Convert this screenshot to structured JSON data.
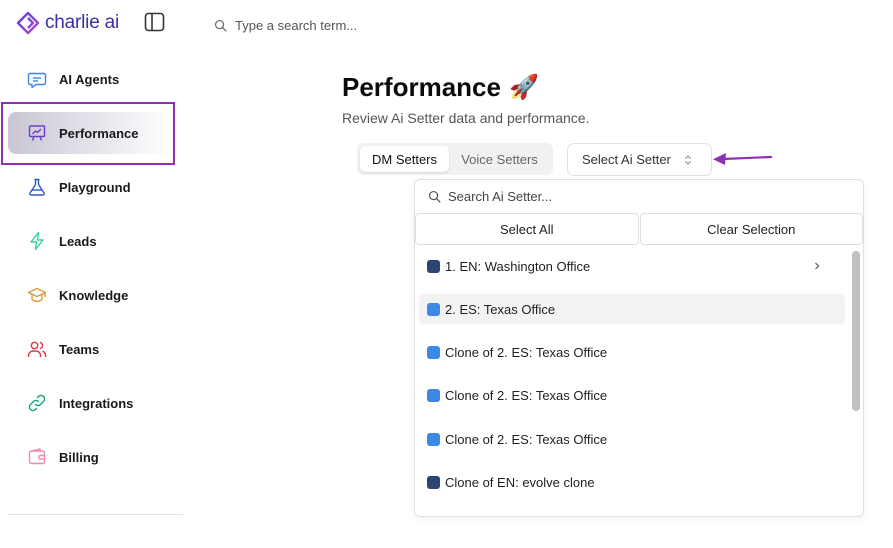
{
  "app": {
    "logo_text": "charlie ai",
    "brand_color": "#3b2fa8"
  },
  "search": {
    "placeholder": "Type a search term..."
  },
  "sidebar": {
    "items": [
      {
        "label": "AI Agents",
        "icon": "chat-icon",
        "color": "#3b82f6"
      },
      {
        "label": "Performance",
        "icon": "presentation-chart-icon",
        "color": "#6d3fc9",
        "active": true
      },
      {
        "label": "Playground",
        "icon": "flask-icon",
        "color": "#2f55c8"
      },
      {
        "label": "Leads",
        "icon": "lightning-icon",
        "color": "#34d399"
      },
      {
        "label": "Knowledge",
        "icon": "graduation-cap-icon",
        "color": "#d89a3b"
      },
      {
        "label": "Teams",
        "icon": "users-icon",
        "color": "#e3344a"
      },
      {
        "label": "Integrations",
        "icon": "link-icon",
        "color": "#14a383"
      },
      {
        "label": "Billing",
        "icon": "wallet-icon",
        "color": "#f08aa8"
      }
    ]
  },
  "main": {
    "title": "Performance",
    "title_emoji": "🚀",
    "subtitle": "Review Ai Setter data and performance.",
    "tabs": [
      {
        "label": "DM Setters",
        "active": true
      },
      {
        "label": "Voice Setters",
        "active": false
      }
    ],
    "select": {
      "label": "Select Ai Setter"
    }
  },
  "dropdown": {
    "search_placeholder": "Search Ai Setter...",
    "select_all": "Select All",
    "clear_selection": "Clear Selection",
    "items": [
      {
        "label": "1. EN: Washington Office",
        "color": "#2b4673",
        "has_submenu": true
      },
      {
        "label": "2. ES: Texas Office",
        "color": "#3b88e6",
        "hovered": true
      },
      {
        "label": "Clone of 2. ES: Texas Office",
        "color": "#3b88e6"
      },
      {
        "label": "Clone of 2. ES: Texas Office",
        "color": "#3b88e6"
      },
      {
        "label": "Clone of 2. ES: Texas Office",
        "color": "#3b88e6"
      },
      {
        "label": "Clone of EN: evolve clone",
        "color": "#2b4673"
      }
    ]
  },
  "annotation": {
    "color": "#8e2fb5"
  }
}
